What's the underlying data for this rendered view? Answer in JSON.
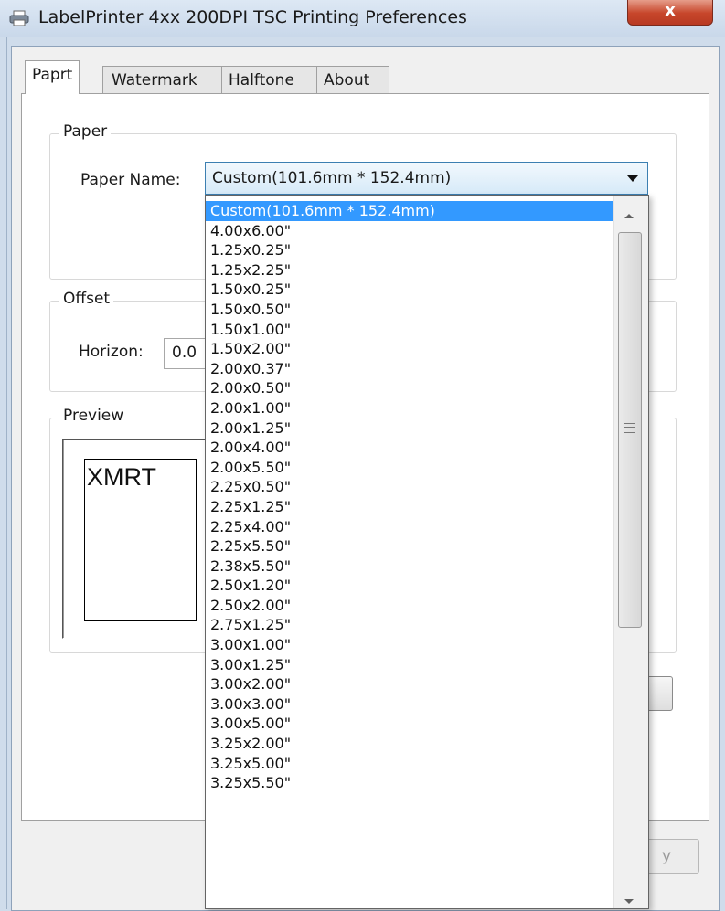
{
  "window": {
    "title": "LabelPrinter 4xx 200DPI TSC Printing Preferences",
    "close_glyph": "x"
  },
  "tabs": [
    {
      "label": "Paprt",
      "active": true
    },
    {
      "label": "Watermark",
      "active": false
    },
    {
      "label": "Halftone",
      "active": false
    },
    {
      "label": "About",
      "active": false
    }
  ],
  "paper": {
    "group_label": "Paper",
    "name_label": "Paper Name:",
    "selected": "Custom(101.6mm * 152.4mm)"
  },
  "offset": {
    "group_label": "Offset",
    "horizon_label": "Horizon:",
    "horizon_value": "0.0"
  },
  "preview": {
    "group_label": "Preview",
    "sample_text": "XMRT"
  },
  "dropdown": {
    "options": [
      "Custom(101.6mm * 152.4mm)",
      "4.00x6.00\"",
      "1.25x0.25\"",
      "1.25x2.25\"",
      "1.50x0.25\"",
      "1.50x0.50\"",
      "1.50x1.00\"",
      "1.50x2.00\"",
      "2.00x0.37\"",
      "2.00x0.50\"",
      "2.00x1.00\"",
      "2.00x1.25\"",
      "2.00x4.00\"",
      "2.00x5.50\"",
      "2.25x0.50\"",
      "2.25x1.25\"",
      "2.25x4.00\"",
      "2.25x5.50\"",
      "2.38x5.50\"",
      "2.50x1.20\"",
      "2.50x2.00\"",
      "2.75x1.25\"",
      "3.00x1.00\"",
      "3.00x1.25\"",
      "3.00x2.00\"",
      "3.00x3.00\"",
      "3.00x5.00\"",
      "3.25x2.00\"",
      "3.25x5.00\"",
      "3.25x5.50\""
    ],
    "selected_index": 0
  },
  "bottom_button": {
    "label": "y"
  },
  "colors": {
    "selection": "#3399ff",
    "combo_border": "#3c7fb1",
    "close_button": "#c7462b"
  }
}
